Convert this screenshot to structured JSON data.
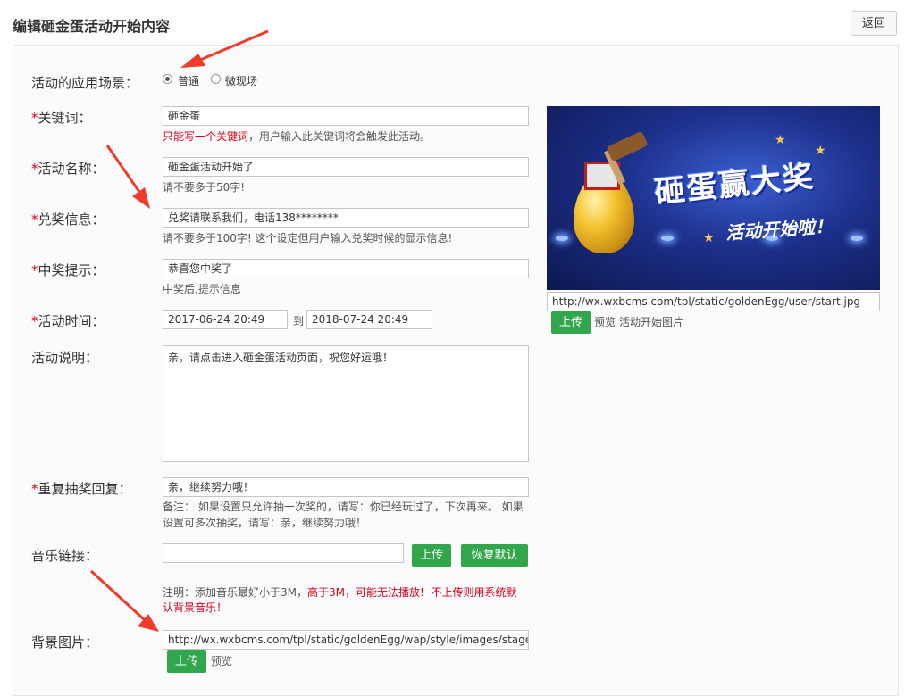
{
  "header": {
    "title": "编辑砸金蛋活动开始内容",
    "back_label": "返回"
  },
  "form": {
    "scene": {
      "label": "活动的应用场景：",
      "options": [
        "普通",
        "微现场"
      ],
      "selected": "普通"
    },
    "keyword": {
      "required": "*",
      "label": "关键词：",
      "value": "砸金蛋",
      "hint_red": "只能写一个关键词",
      "hint_rest": "，用户输入此关键词将会触发此活动。"
    },
    "name": {
      "required": "*",
      "label": "活动名称：",
      "value": "砸金蛋活动开始了",
      "hint": "请不要多于50字!"
    },
    "prize_info": {
      "required": "*",
      "label": "兑奖信息：",
      "value": "兑奖请联系我们，电话138********",
      "hint": "请不要多于100字! 这个设定但用户输入兑奖时候的显示信息!"
    },
    "win_tip": {
      "required": "*",
      "label": "中奖提示：",
      "value": "恭喜您中奖了",
      "hint": "中奖后,提示信息"
    },
    "time": {
      "required": "*",
      "label": "活动时间：",
      "start": "2017-06-24 20:49",
      "to": "到",
      "end": "2018-07-24 20:49"
    },
    "description": {
      "label": "活动说明：",
      "value": "亲，请点击进入砸金蛋活动页面，祝您好运哦！"
    },
    "repeat_reply": {
      "required": "*",
      "label": "重复抽奖回复：",
      "value": "亲，继续努力哦！",
      "hint_line1": "备注： 如果设置只允许抽一次奖的，请写：你已经玩过了，下次再来。 如果",
      "hint_line2": "设置可多次抽奖，请写：亲，继续努力哦！"
    },
    "music": {
      "label": "音乐链接：",
      "value": "",
      "upload_label": "上传",
      "reset_label": "恢复默认",
      "note_prefix": "注明：添加音乐最好小于3M，",
      "note_red1": "高于3M，可能无法播放!",
      "note_red2": "不上传则用系统默",
      "note_red3": "认背景音乐！"
    },
    "background": {
      "label": "背景图片：",
      "value": "http://wx.wxbcms.com/tpl/static/goldenEgg/wap/style/images/stage.",
      "upload_label": "上传",
      "preview_label": "预览"
    }
  },
  "start_image": {
    "banner_main": "砸蛋赢大奖",
    "banner_sub": "活动开始啦！",
    "url": "http://wx.wxbcms.com/tpl/static/goldenEgg/user/start.jpg",
    "upload_label": "上传",
    "preview_label": "预览",
    "caption": "活动开始图片"
  },
  "colors": {
    "required_red": "#d9001b",
    "button_green": "#32a64c",
    "annotation_arrow": "#f03a2e"
  }
}
